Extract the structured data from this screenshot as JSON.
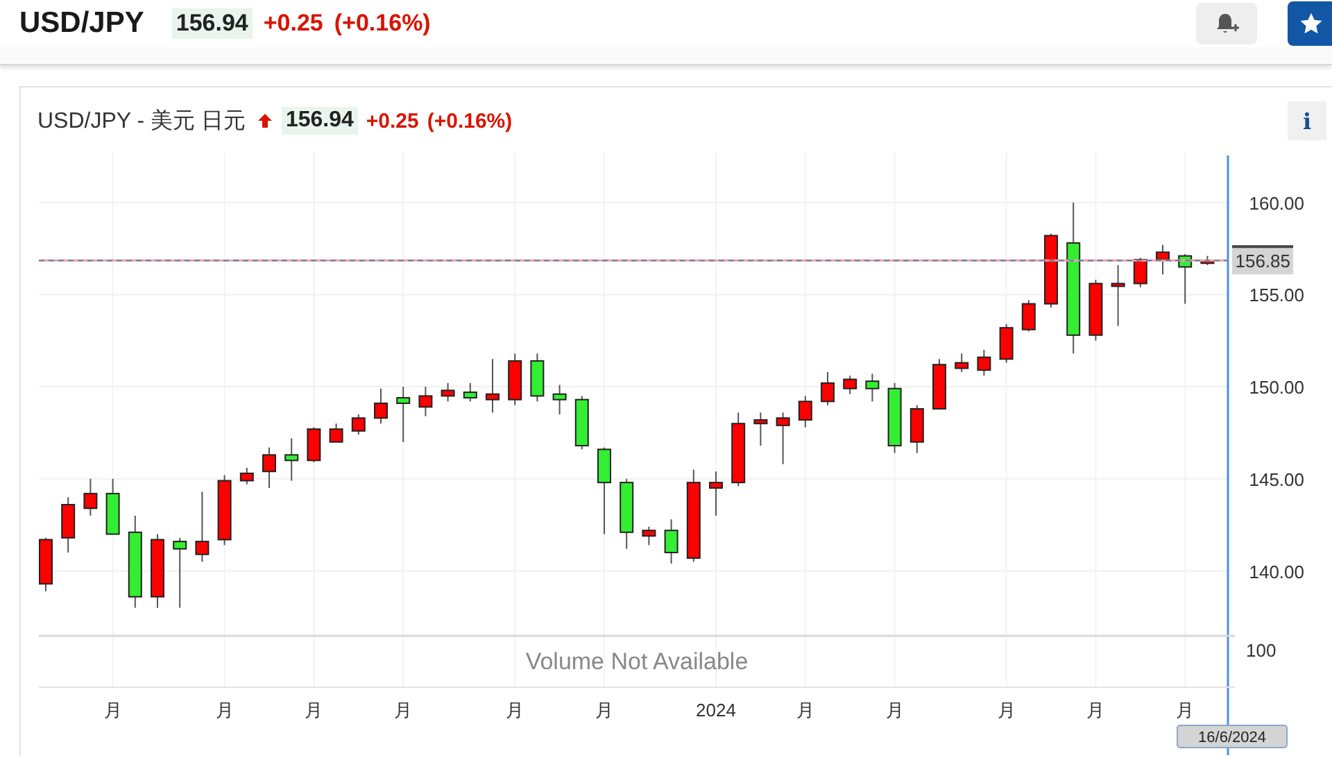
{
  "header": {
    "symbol": "USD/JPY",
    "price": "156.94",
    "change": "+0.25",
    "change_pct": "(+0.16%)",
    "rising": true
  },
  "chart_panel": {
    "title": "USD/JPY - 美元 日元",
    "rising": true,
    "price": "156.94",
    "change": "+0.25",
    "change_pct": "(+0.16%)",
    "info_button": "i",
    "current_price_label": "156.85",
    "volume_message": "Volume Not Available",
    "volume_axis_label": "100",
    "cursor_date": "16/6/2024",
    "chart_data": {
      "type": "candlestick",
      "ylim": [
        130,
        162.7
      ],
      "grid": true,
      "categories": [
        null,
        null,
        null,
        "月",
        null,
        null,
        null,
        null,
        "月",
        null,
        null,
        null,
        "月",
        null,
        null,
        null,
        "月",
        null,
        null,
        null,
        null,
        "月",
        null,
        null,
        null,
        "月",
        null,
        null,
        null,
        null,
        "2024",
        null,
        null,
        null,
        "月",
        null,
        null,
        null,
        "月",
        null,
        null,
        null,
        null,
        "月",
        null,
        null,
        null,
        "月",
        null,
        null,
        null,
        "月",
        null
      ],
      "yticks": [
        {
          "value": 160,
          "label": "160.00"
        },
        {
          "value": 155,
          "label": "155.00"
        },
        {
          "value": 150,
          "label": "150.00"
        },
        {
          "value": 145,
          "label": "145.00"
        },
        {
          "value": 140,
          "label": "140.00"
        }
      ],
      "ohlc": [
        [
          139.3,
          141.8,
          138.9,
          141.7
        ],
        [
          141.8,
          144,
          141,
          143.6
        ],
        [
          143.4,
          145,
          143,
          144.2
        ],
        [
          144.2,
          145,
          142,
          142
        ],
        [
          142.1,
          143,
          138,
          138.6
        ],
        [
          138.6,
          142,
          138,
          141.7
        ],
        [
          141.6,
          141.8,
          138,
          141.2
        ],
        [
          140.9,
          144.3,
          140.5,
          141.6
        ],
        [
          141.7,
          145.2,
          141.4,
          144.9
        ],
        [
          144.9,
          145.6,
          144.7,
          145.3
        ],
        [
          145.4,
          146.7,
          144.5,
          146.3
        ],
        [
          146.3,
          147.2,
          144.9,
          146
        ],
        [
          146,
          147.8,
          145.9,
          147.7
        ],
        [
          147,
          148,
          147,
          147.7
        ],
        [
          147.6,
          148.5,
          147.4,
          148.3
        ],
        [
          148.3,
          149.9,
          148,
          149.1
        ],
        [
          149.4,
          150,
          147,
          149.1
        ],
        [
          148.9,
          150,
          148.4,
          149.5
        ],
        [
          149.5,
          150.2,
          149.2,
          149.8
        ],
        [
          149.7,
          150.2,
          149.2,
          149.4
        ],
        [
          149.3,
          151.5,
          148.6,
          149.6
        ],
        [
          149.3,
          151.8,
          149,
          151.4
        ],
        [
          151.4,
          151.8,
          149.2,
          149.5
        ],
        [
          149.6,
          150.1,
          148.5,
          149.3
        ],
        [
          149.3,
          149.5,
          146.6,
          146.8
        ],
        [
          146.6,
          146.7,
          142,
          144.8
        ],
        [
          144.8,
          145,
          141.2,
          142.1
        ],
        [
          141.9,
          142.4,
          141.4,
          142.2
        ],
        [
          142.2,
          142.8,
          140.4,
          141
        ],
        [
          140.7,
          145.5,
          140.5,
          144.8
        ],
        [
          144.5,
          145.4,
          143,
          144.8
        ],
        [
          144.8,
          148.6,
          144.6,
          148
        ],
        [
          148,
          148.6,
          146.8,
          148.2
        ],
        [
          147.9,
          148.6,
          145.8,
          148.3
        ],
        [
          148.2,
          149.5,
          147.8,
          149.2
        ],
        [
          149.2,
          150.8,
          149,
          150.2
        ],
        [
          149.9,
          150.6,
          149.6,
          150.4
        ],
        [
          150.3,
          150.7,
          149.2,
          149.9
        ],
        [
          149.9,
          150.2,
          146.4,
          146.8
        ],
        [
          147,
          149,
          146.4,
          148.8
        ],
        [
          148.8,
          151.5,
          148.8,
          151.2
        ],
        [
          151,
          151.8,
          150.8,
          151.3
        ],
        [
          150.9,
          152,
          150.6,
          151.6
        ],
        [
          151.5,
          153.4,
          151.3,
          153.2
        ],
        [
          153.1,
          154.7,
          153,
          154.5
        ],
        [
          154.5,
          158.3,
          154.3,
          158.2
        ],
        [
          157.8,
          160,
          151.8,
          152.8
        ],
        [
          152.8,
          155.8,
          152.5,
          155.6
        ],
        [
          155.5,
          156.6,
          153.3,
          155.6
        ],
        [
          155.6,
          157,
          155.4,
          156.9
        ],
        [
          156.9,
          157.7,
          156.1,
          157.3
        ],
        [
          157.1,
          157.2,
          154.5,
          156.5
        ],
        [
          156.7,
          157.1,
          156.6,
          156.85
        ]
      ]
    }
  }
}
